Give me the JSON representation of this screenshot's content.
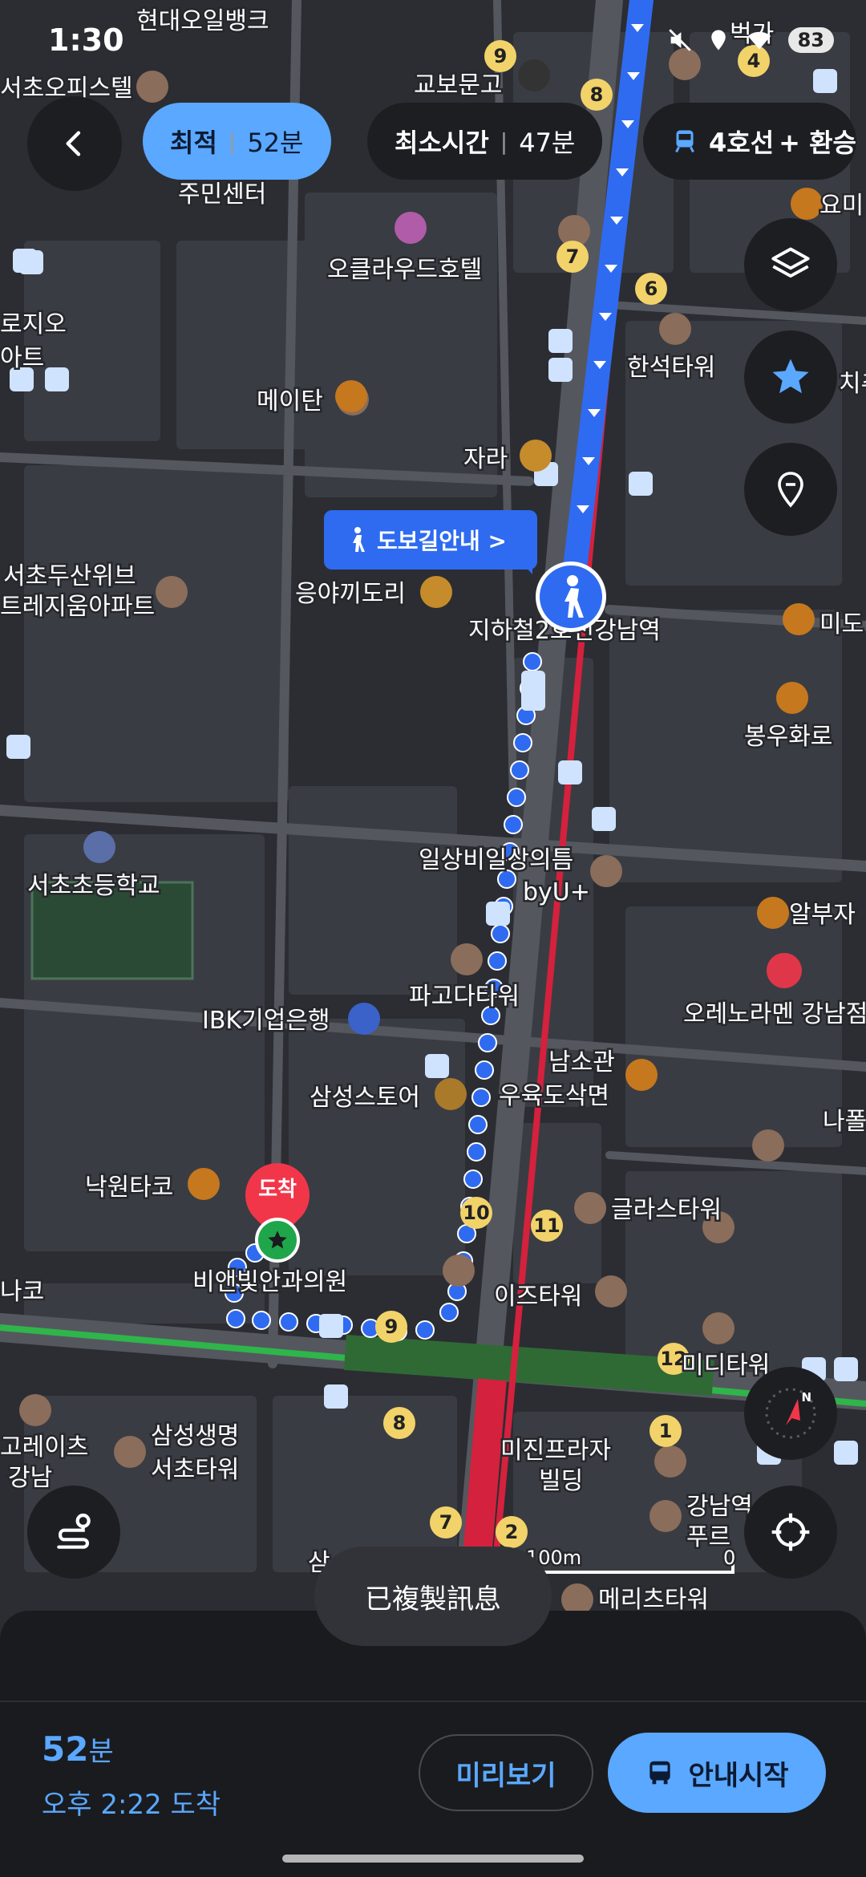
{
  "status_bar": {
    "time": "1:30",
    "battery": "83"
  },
  "route_options": {
    "optimal_label": "최적",
    "optimal_time": "52분",
    "shortest_label": "최소시간",
    "shortest_time": "47분",
    "line_label": "4호선",
    "line_extra": "+ 환승"
  },
  "map": {
    "walk_banner": "도보길안내 >",
    "destination_pin": "도착",
    "scale_label": "100m",
    "scale_zero": "0",
    "places": [
      "현대오일뱅크",
      "서초오피스텔",
      "교보문고",
      "주민센터",
      "오클라우드호텔",
      "로지오",
      "아트",
      "한석타워",
      "메이탄",
      "자라",
      "서초두산위브",
      "트레지움아파트",
      "응야끼도리",
      "지하철2호선강남역",
      "미도",
      "봉우화로",
      "서초초등학교",
      "일상비일상의틈",
      "byU+",
      "알부자",
      "오레노라멘 강남점",
      "IBK기업은행",
      "파고다타워",
      "남소관",
      "삼성스토어",
      "우육도삭면",
      "나폴",
      "낙원타코",
      "글라스타워",
      "비앤빛안과의원",
      "이즈타워",
      "나코",
      "미디타워",
      "고레이츠",
      "강남",
      "삼성생명",
      "서초타워",
      "미진프라자",
      "빌딩",
      "강남역",
      "푸르",
      "메리츠타워",
      "요미",
      "치추",
      "삼",
      "벅가"
    ],
    "exit_numbers": [
      "9",
      "8",
      "7",
      "6",
      "4",
      "10",
      "11",
      "9",
      "12",
      "8",
      "1",
      "7",
      "2"
    ]
  },
  "toast": "已複製訊息",
  "bottom": {
    "minutes_value": "52",
    "minutes_unit": "분",
    "arrival": "오후 2:22 도착",
    "preview_button": "미리보기",
    "start_button": "안내시작"
  },
  "colors": {
    "accent": "#5aa8ff",
    "route_walk": "#2f6bf0",
    "subway_line2": "#2fb54a",
    "subway_sinbundang": "#d4213d",
    "destination": "#f2364a"
  },
  "icons": [
    "back-icon",
    "layers-icon",
    "star-icon",
    "location-pin-icon",
    "compass-icon",
    "route-icon",
    "my-location-icon",
    "pedestrian-icon",
    "bus-icon",
    "train-icon"
  ]
}
